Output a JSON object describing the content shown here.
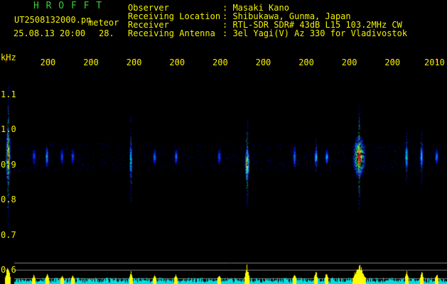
{
  "header": {
    "brand": "H R O F F T",
    "filename": "UT2508132000.pn",
    "mode": "meteor",
    "datetime": "25.08.13 20:00",
    "count": "28.",
    "info_rows": [
      {
        "label": "Observer",
        "value": ": Masaki Kano"
      },
      {
        "label": "Receiving Location",
        "value": ": Shibukawa, Gunma, Japan"
      },
      {
        "label": "Receiver",
        "value": ": RTL-SDR SDR# 43dB L15 103.2MHz CW"
      },
      {
        "label": "Receiving Antenna",
        "value": ": 3el Yagi(V) Az 330 for Vladivostok"
      }
    ]
  },
  "colors": {
    "background": "#000000",
    "label_green": "#35d035",
    "label_yellow": "#f2f000",
    "text_white": "#f2f2f2",
    "tick_red": "#e02020",
    "profile_yellow": "#ffff00",
    "profile_cyan": "#00e0e0",
    "grid_gray": "#808080"
  },
  "chart_data": {
    "type": "heatmap",
    "ylabel": "kHz",
    "ylim": [
      0.6,
      1.2
    ],
    "y_ticks": [
      "1.1",
      "1.0",
      "0.9",
      "0.8",
      "0.7",
      "0.6"
    ],
    "x_ticks": [
      "200",
      "200",
      "200",
      "200",
      "200",
      "200",
      "200",
      "200",
      "200",
      "2010"
    ],
    "x_tick_minutes": [
      0,
      1,
      2,
      3,
      4,
      5,
      6,
      7,
      8,
      9,
      10
    ],
    "signal_line_khz": 0.92,
    "echoes": [
      {
        "t_min": 0.05,
        "khz": 0.92,
        "intensity": 0.9,
        "duration_min": 0.12,
        "spread_khz": 0.08
      },
      {
        "t_min": 0.65,
        "khz": 0.92,
        "intensity": 0.3,
        "duration_min": 0.06,
        "spread_khz": 0.02
      },
      {
        "t_min": 0.95,
        "khz": 0.92,
        "intensity": 0.45,
        "duration_min": 0.05,
        "spread_khz": 0.03
      },
      {
        "t_min": 1.3,
        "khz": 0.92,
        "intensity": 0.3,
        "duration_min": 0.04,
        "spread_khz": 0.02
      },
      {
        "t_min": 1.55,
        "khz": 0.92,
        "intensity": 0.3,
        "duration_min": 0.04,
        "spread_khz": 0.02
      },
      {
        "t_min": 2.9,
        "khz": 0.91,
        "intensity": 0.55,
        "duration_min": 0.05,
        "spread_khz": 0.05
      },
      {
        "t_min": 3.45,
        "khz": 0.92,
        "intensity": 0.35,
        "duration_min": 0.04,
        "spread_khz": 0.02
      },
      {
        "t_min": 3.95,
        "khz": 0.92,
        "intensity": 0.4,
        "duration_min": 0.05,
        "spread_khz": 0.02
      },
      {
        "t_min": 4.95,
        "khz": 0.92,
        "intensity": 0.35,
        "duration_min": 0.04,
        "spread_khz": 0.02
      },
      {
        "t_min": 5.6,
        "khz": 0.9,
        "intensity": 0.9,
        "duration_min": 0.1,
        "spread_khz": 0.05
      },
      {
        "t_min": 6.7,
        "khz": 0.92,
        "intensity": 0.4,
        "duration_min": 0.05,
        "spread_khz": 0.03
      },
      {
        "t_min": 7.2,
        "khz": 0.92,
        "intensity": 0.6,
        "duration_min": 0.05,
        "spread_khz": 0.02
      },
      {
        "t_min": 7.45,
        "khz": 0.92,
        "intensity": 0.5,
        "duration_min": 0.04,
        "spread_khz": 0.02
      },
      {
        "t_min": 8.2,
        "khz": 0.92,
        "intensity": 1.0,
        "duration_min": 0.3,
        "spread_khz": 0.06
      },
      {
        "t_min": 9.3,
        "khz": 0.92,
        "intensity": 0.6,
        "duration_min": 0.06,
        "spread_khz": 0.03
      },
      {
        "t_min": 9.65,
        "khz": 0.92,
        "intensity": 0.55,
        "duration_min": 0.05,
        "spread_khz": 0.03
      },
      {
        "t_min": 10.0,
        "khz": 0.92,
        "intensity": 0.4,
        "duration_min": 0.04,
        "spread_khz": 0.02
      }
    ]
  }
}
